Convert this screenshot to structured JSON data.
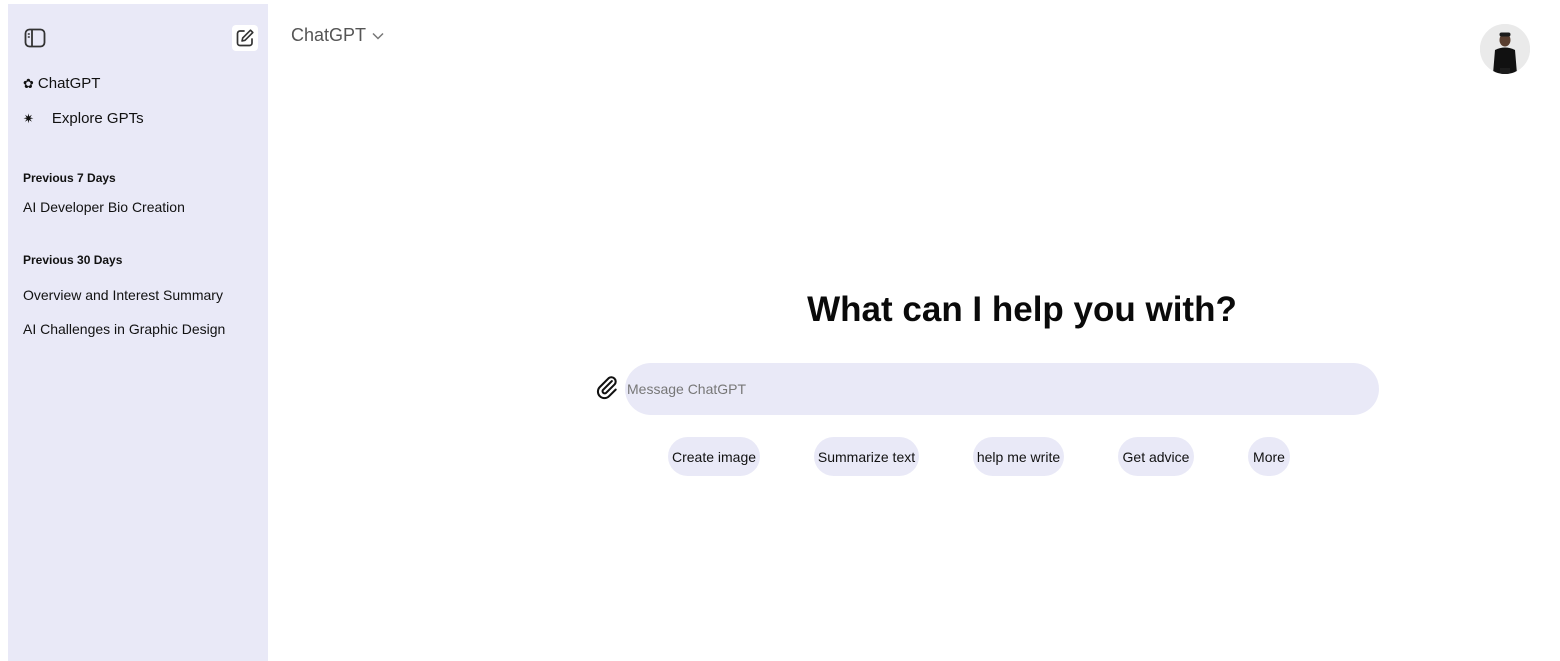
{
  "sidebar": {
    "toggle_icon": "sidebar-toggle-icon",
    "new_chat_icon": "edit-icon",
    "nav": [
      {
        "label": "ChatGPT",
        "glyph": "✿"
      },
      {
        "label": "Explore GPTs",
        "glyph": "✷"
      }
    ],
    "sections": [
      {
        "heading": "Previous 7 Days",
        "items": [
          "AI Developer Bio Creation"
        ]
      },
      {
        "heading": "Previous 30 Days",
        "items": [
          "Overview and Interest Summary",
          "AI Challenges in Graphic Design"
        ]
      }
    ]
  },
  "header": {
    "model": "ChatGPT"
  },
  "main": {
    "headline": "What can I help you with?",
    "input_placeholder": "Message ChatGPT",
    "chips": [
      "Create image",
      "Summarize text",
      "help me write",
      "Get advice",
      "More"
    ]
  },
  "colors": {
    "sidebar_bg": "#e9e9f7",
    "chip_bg": "#e9e9f7",
    "text": "#0d0d0d"
  }
}
